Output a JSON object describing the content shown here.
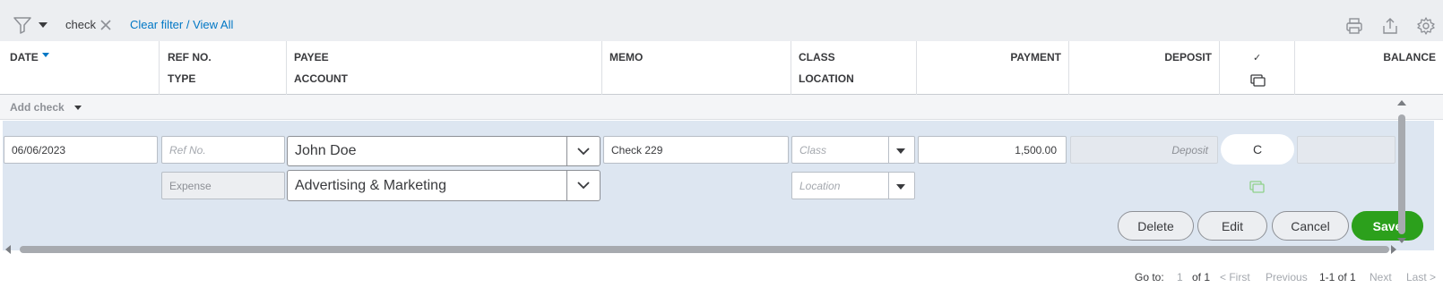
{
  "filter": {
    "active_filter": "check",
    "clear_link": "Clear filter / View All"
  },
  "columns": {
    "date": "DATE",
    "ref_no": "REF NO.",
    "type": "TYPE",
    "payee": "PAYEE",
    "account": "ACCOUNT",
    "memo": "MEMO",
    "class": "CLASS",
    "location": "LOCATION",
    "payment": "PAYMENT",
    "deposit": "DEPOSIT",
    "cleared": "✓",
    "balance": "BALANCE"
  },
  "add_row": {
    "label": "Add check"
  },
  "edit_row": {
    "date": "06/06/2023",
    "ref_placeholder": "Ref No.",
    "type": "Expense",
    "payee": "John Doe",
    "account": "Advertising & Marketing",
    "memo": "Check 229",
    "class_placeholder": "Class",
    "location_placeholder": "Location",
    "payment": "1,500.00",
    "deposit_placeholder": "Deposit",
    "cleared_status": "C"
  },
  "actions": {
    "delete": "Delete",
    "edit": "Edit",
    "cancel": "Cancel",
    "save": "Save"
  },
  "pagination": {
    "goto_label": "Go to:",
    "page_input": "1",
    "of_pages": "of 1",
    "first": "< First",
    "previous": "Previous",
    "range": "1-1 of 1",
    "next": "Next",
    "last": "Last >"
  },
  "colors": {
    "accent_green": "#2ca01c",
    "link_blue": "#0077c5",
    "edit_bg": "#dde6f1",
    "toolbar_bg": "#eceef1"
  }
}
